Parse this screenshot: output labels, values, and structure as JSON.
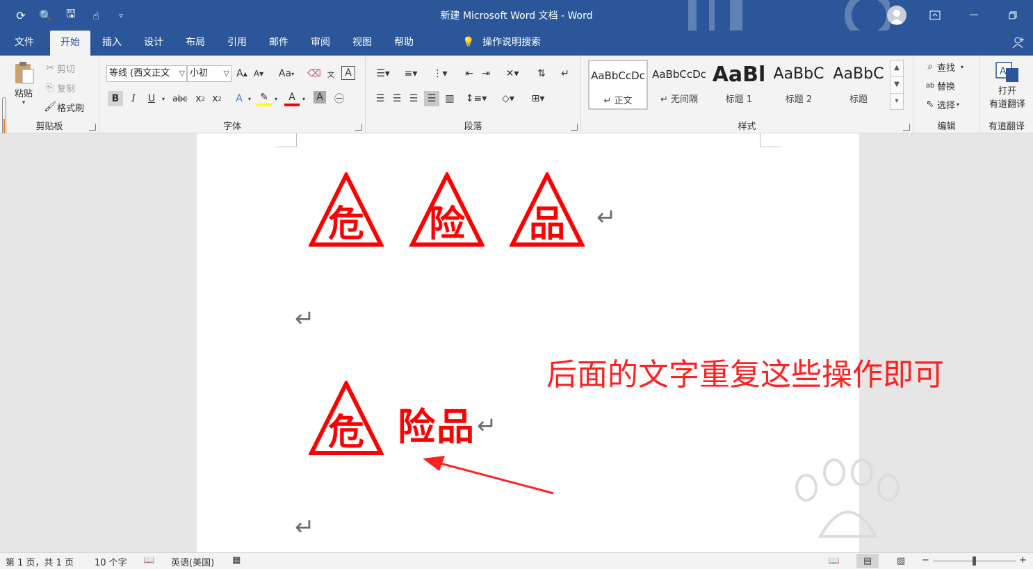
{
  "window": {
    "title": "新建 Microsoft Word 文档  -  Word"
  },
  "tabs": [
    {
      "label": "文件"
    },
    {
      "label": "开始"
    },
    {
      "label": "插入"
    },
    {
      "label": "设计"
    },
    {
      "label": "布局"
    },
    {
      "label": "引用"
    },
    {
      "label": "邮件"
    },
    {
      "label": "审阅"
    },
    {
      "label": "视图"
    },
    {
      "label": "帮助"
    }
  ],
  "active_tab": "开始",
  "tell_me": "操作说明搜索",
  "clipboard": {
    "paste": "粘贴",
    "cut": "剪切",
    "copy": "复制",
    "format_painter": "格式刷",
    "group_label": "剪贴板"
  },
  "font": {
    "font_name": "等线 (西文正文",
    "font_size": "小初",
    "change_case": "Aa",
    "bold": "B",
    "italic": "I",
    "underline": "U",
    "strikethrough": "abc",
    "subscript": "x",
    "superscript": "x",
    "group_label": "字体"
  },
  "paragraph": {
    "group_label": "段落"
  },
  "styles": {
    "items": [
      {
        "preview": "AaBbCcDc",
        "name": "↵ 正文"
      },
      {
        "preview": "AaBbCcDc",
        "name": "↵ 无间隔"
      },
      {
        "preview": "AaBl",
        "name": "标题 1"
      },
      {
        "preview": "AaBbC",
        "name": "标题 2"
      },
      {
        "preview": "AaBbC",
        "name": "标题"
      }
    ],
    "group_label": "样式"
  },
  "editing": {
    "find": "查找",
    "replace": "替换",
    "select": "选择",
    "group_label": "编辑"
  },
  "youdao": {
    "open_line1": "打开",
    "open_line2": "有道翻译",
    "group_label": "有道翻译"
  },
  "document": {
    "signs_row": [
      "危",
      "险",
      "品"
    ],
    "single_sign": "危",
    "trailing_text": "险品",
    "annotation": "后面的文字重复这些操作即可",
    "paragraph_mark": "↵"
  },
  "colors": {
    "title_bar": "#2b579a",
    "sign_red": "#ff0000",
    "annotation_red": "#ff2020"
  },
  "status": {
    "page": "第 1 页，共 1 页",
    "words": "10 个字",
    "language": "英语(美国)"
  }
}
